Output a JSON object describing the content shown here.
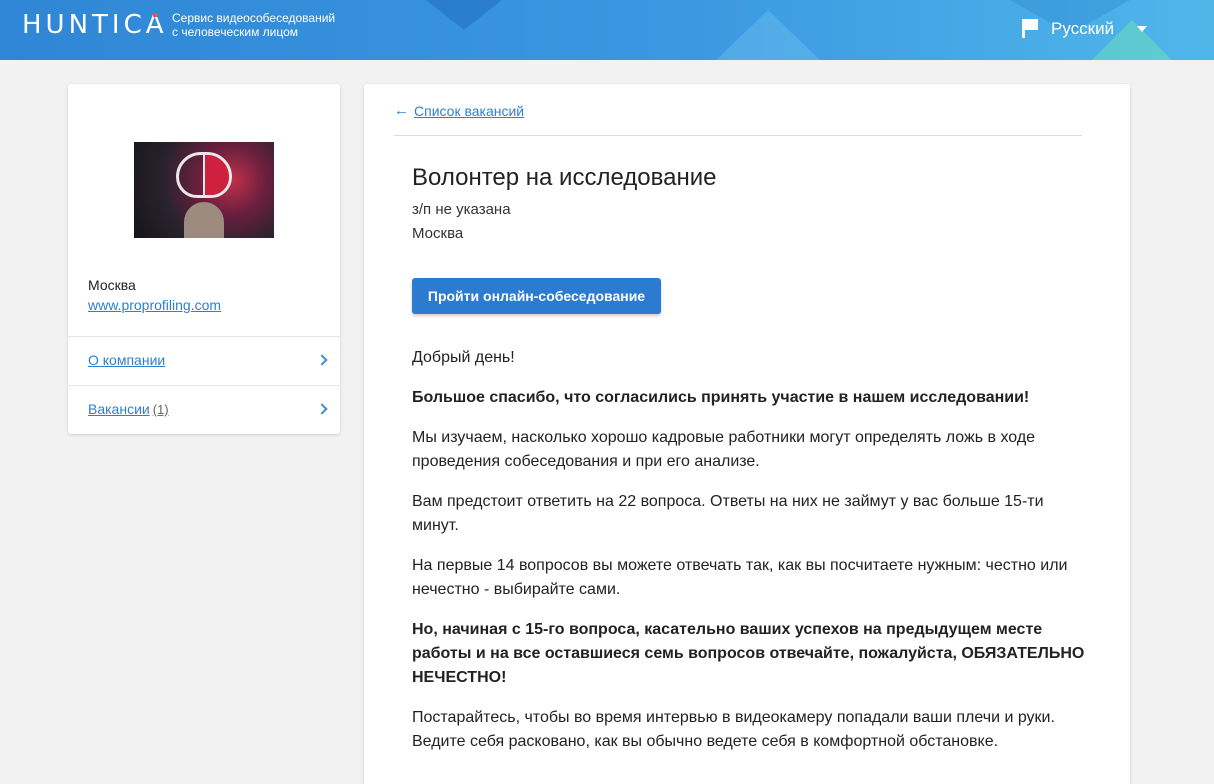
{
  "header": {
    "logo": "HUNTICA",
    "tagline_line1": "Сервис видеособеседований",
    "tagline_line2": "с человеческим лицом",
    "language": "Русский",
    "accent_color": "#2f86d6"
  },
  "sidebar": {
    "city": "Москва",
    "website": "www.proprofiling.com",
    "items": [
      {
        "label": "О компании",
        "count": ""
      },
      {
        "label": "Вакансии",
        "count": "(1)"
      }
    ]
  },
  "main": {
    "back_label": "Список вакансий",
    "title": "Волонтер на исследование",
    "salary": "з/п не указана",
    "city": "Москва",
    "apply_button": "Пройти онлайн-собеседование",
    "paragraphs": [
      {
        "text": "Добрый день!",
        "bold": false
      },
      {
        "text": "Большое спасибо, что согласились принять участие в нашем исследовании!",
        "bold": true
      },
      {
        "text": "Мы изучаем, насколько хорошо кадровые работники могут определять ложь в ходе проведения собеседования и при его анализе.",
        "bold": false
      },
      {
        "text": "Вам предстоит ответить на 22 вопроса. Ответы на них не займут у вас больше 15-ти минут.",
        "bold": false
      },
      {
        "text": "На первые 14 вопросов вы можете отвечать так, как вы посчитаете нужным: честно или нечестно - выбирайте сами.",
        "bold": false
      },
      {
        "text": "Но, начиная с 15-го вопроса, касательно ваших успехов на предыдущем месте работы и на все оставшиеся семь вопросов отвечайте, пожалуйста, ОБЯЗАТЕЛЬНО НЕЧЕСТНО!",
        "bold": true
      },
      {
        "text": "Постарайтесь, чтобы во время интервью в видеокамеру попадали ваши плечи и руки. Ведите себя расковано, как вы обычно ведете себя в комфортной обстановке.",
        "bold": false
      }
    ]
  }
}
